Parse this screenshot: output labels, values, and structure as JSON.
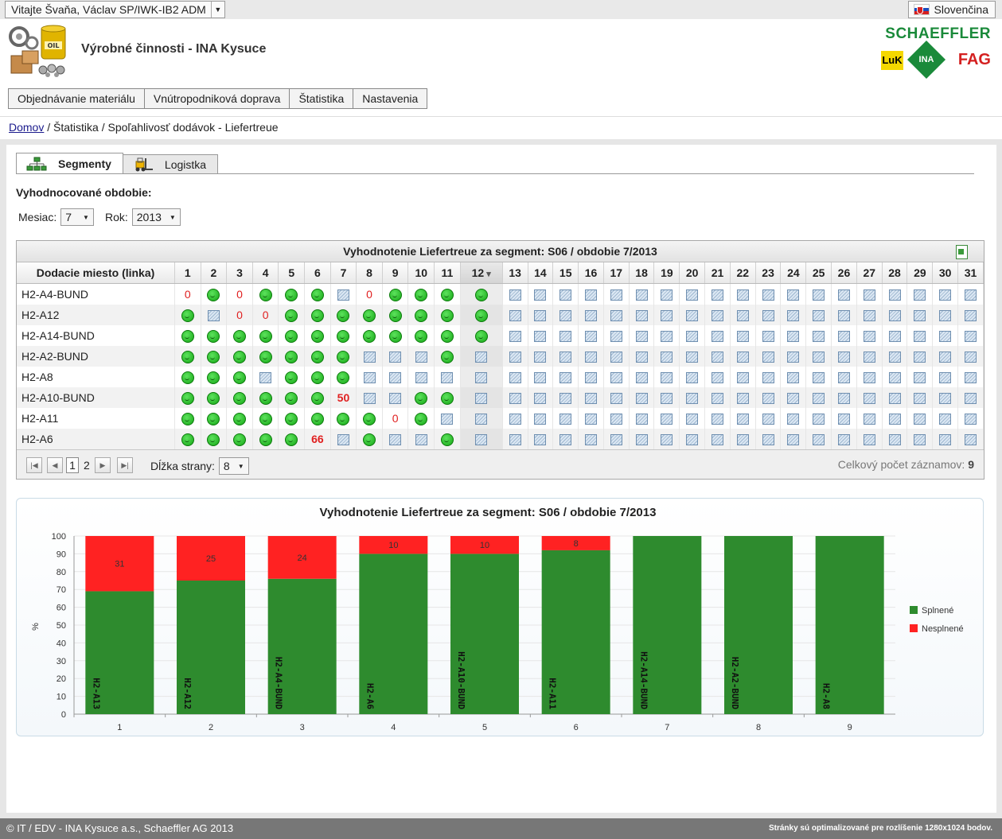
{
  "topbar": {
    "user": "Vitajte Švaňa, Václav SP/IWK-IB2 ADM",
    "language": "Slovenčina"
  },
  "header": {
    "app_title": "Výrobné činnosti - INA Kysuce",
    "brand_main": "SCHAEFFLER",
    "brand_luk": "LuK",
    "brand_ina": "INA",
    "brand_fag": "FAG"
  },
  "menu": [
    "Objednávanie materiálu",
    "Vnútropodniková doprava",
    "Štatistika",
    "Nastavenia"
  ],
  "breadcrumb": {
    "home": "Domov",
    "rest": " / Štatistika / Spoľahlivosť dodávok - Liefertreue"
  },
  "tabs": [
    {
      "label": "Segmenty",
      "active": true
    },
    {
      "label": "Logistka",
      "active": false
    }
  ],
  "filters": {
    "period_label": "Vyhodnocované obdobie:",
    "month_label": "Mesiac:",
    "month_value": "7",
    "year_label": "Rok:",
    "year_value": "2013"
  },
  "grid": {
    "title": "Vyhodnotenie Liefertreue za segment: S06 / obdobie 7/2013",
    "location_header": "Dodacie miesto (linka)",
    "days": [
      "1",
      "2",
      "3",
      "4",
      "5",
      "6",
      "7",
      "8",
      "9",
      "10",
      "11",
      "12",
      "13",
      "14",
      "15",
      "16",
      "17",
      "18",
      "19",
      "20",
      "21",
      "22",
      "23",
      "24",
      "25",
      "26",
      "27",
      "28",
      "29",
      "30",
      "31"
    ],
    "sorted_day": "12",
    "rows": [
      {
        "location": "H2-A4-BUND",
        "cells": [
          "0",
          "ok",
          "0",
          "ok",
          "ok",
          "ok",
          "-",
          "0",
          "ok",
          "ok",
          "ok",
          "ok"
        ]
      },
      {
        "location": "H2-A12",
        "cells": [
          "ok",
          "-",
          "0",
          "0",
          "ok",
          "ok",
          "ok",
          "ok",
          "ok",
          "ok",
          "ok",
          "ok"
        ]
      },
      {
        "location": "H2-A14-BUND",
        "cells": [
          "ok",
          "ok",
          "ok",
          "ok",
          "ok",
          "ok",
          "ok",
          "ok",
          "ok",
          "ok",
          "ok",
          "ok"
        ]
      },
      {
        "location": "H2-A2-BUND",
        "cells": [
          "ok",
          "ok",
          "ok",
          "ok",
          "ok",
          "ok",
          "ok",
          "-",
          "-",
          "-",
          "ok",
          "-"
        ]
      },
      {
        "location": "H2-A8",
        "cells": [
          "ok",
          "ok",
          "ok",
          "-",
          "ok",
          "ok",
          "ok",
          "-",
          "-",
          "-",
          "-",
          "-"
        ]
      },
      {
        "location": "H2-A10-BUND",
        "cells": [
          "ok",
          "ok",
          "ok",
          "ok",
          "ok",
          "ok",
          "50",
          "-",
          "-",
          "ok",
          "ok",
          "-"
        ]
      },
      {
        "location": "H2-A11",
        "cells": [
          "ok",
          "ok",
          "ok",
          "ok",
          "ok",
          "ok",
          "ok",
          "ok",
          "0",
          "ok",
          "-",
          "-"
        ]
      },
      {
        "location": "H2-A6",
        "cells": [
          "ok",
          "ok",
          "ok",
          "ok",
          "ok",
          "66",
          "-",
          "ok",
          "-",
          "-",
          "ok",
          "-"
        ]
      }
    ],
    "bold_values": [
      "50",
      "66"
    ],
    "pager": {
      "pages": [
        "1",
        "2"
      ],
      "current_page": "1",
      "page_length_label": "Dĺžka strany:",
      "page_length": "8",
      "total_label": "Celkový počet záznamov:",
      "total": "9"
    }
  },
  "chart_data": {
    "type": "bar",
    "title": "Vyhodnotenie Liefertreue za segment: S06  / obdobie 7/2013",
    "ylabel": "%",
    "ylim": [
      0,
      100
    ],
    "yticks": [
      "0",
      "10",
      "20",
      "30",
      "40",
      "50",
      "60",
      "70",
      "80",
      "90",
      "100"
    ],
    "categories": [
      "1",
      "2",
      "3",
      "4",
      "5",
      "6",
      "7",
      "8",
      "9"
    ],
    "bar_labels": [
      "H2-A13",
      "H2-A12",
      "H2-A4-BUND",
      "H2-A6",
      "H2-A10-BUND",
      "H2-A11",
      "H2-A14-BUND",
      "H2-A2-BUND",
      "H2-A8"
    ],
    "stacked": true,
    "series": [
      {
        "name": "Splnené",
        "color": "#2e8b2e",
        "values": [
          69,
          75,
          76,
          90,
          90,
          92,
          100,
          100,
          100
        ]
      },
      {
        "name": "Nesplnené",
        "color": "#ff2222",
        "values": [
          31,
          25,
          24,
          10,
          10,
          8,
          0,
          0,
          0
        ]
      }
    ],
    "legend_position": "right",
    "grid": true
  },
  "footer": {
    "left": "© IT / EDV - INA Kysuce a.s., Schaeffler AG 2013",
    "right": "Stránky sú optimalizované pre rozlíšenie 1280x1024 bodov."
  }
}
